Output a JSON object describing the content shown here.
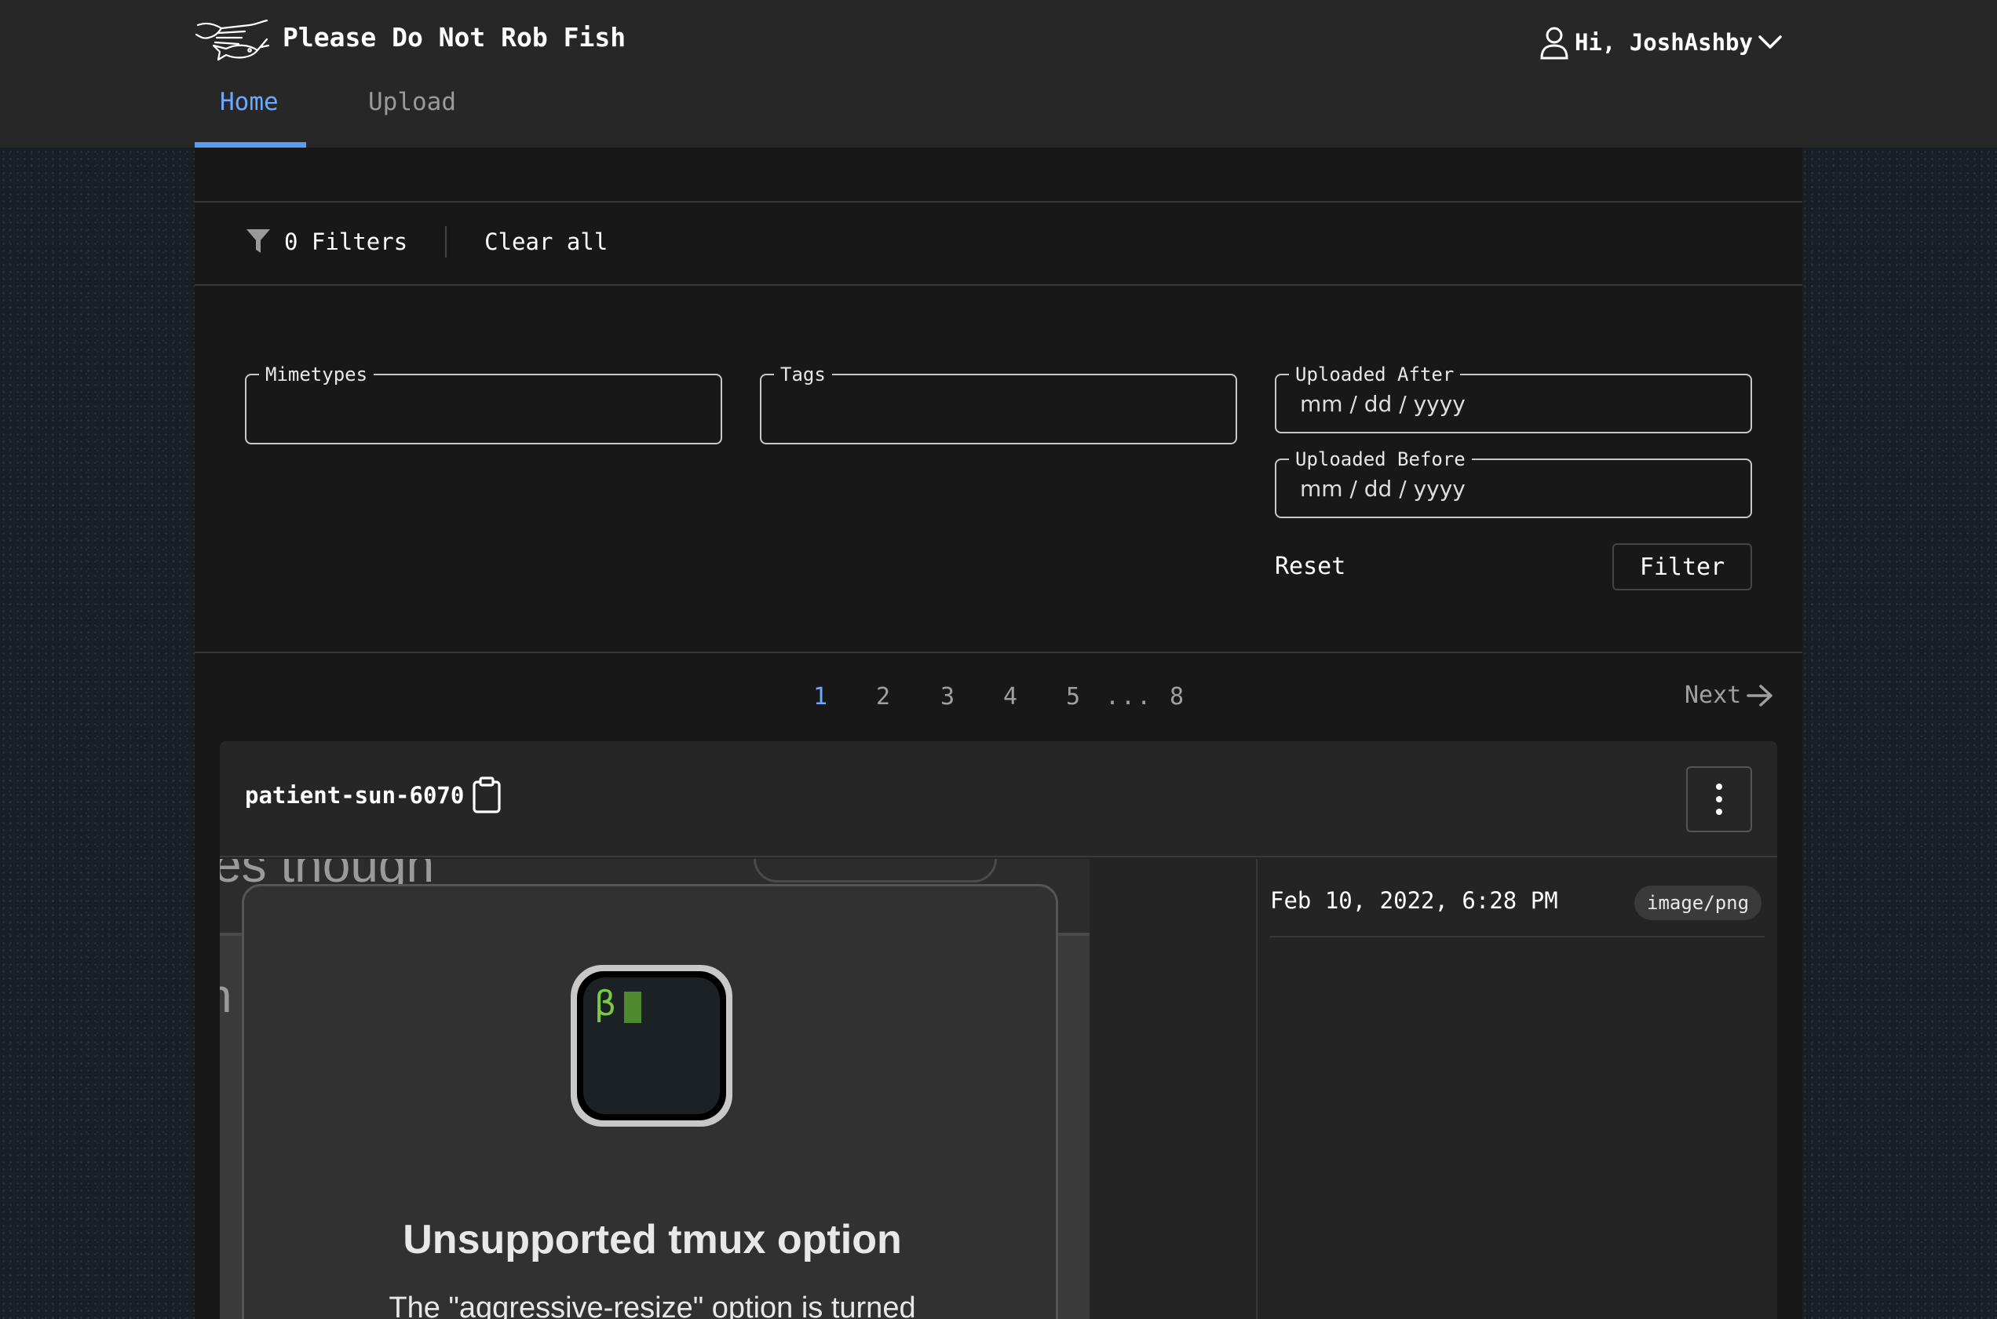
{
  "app": {
    "title": "Please Do Not Rob Fish"
  },
  "user": {
    "greeting": "Hi, JoshAshby"
  },
  "tabs": [
    {
      "label": "Home",
      "active": true
    },
    {
      "label": "Upload",
      "active": false
    }
  ],
  "filters": {
    "count_label": "0 Filters",
    "clear_all": "Clear all",
    "fields": {
      "mimetypes": {
        "legend": "Mimetypes",
        "value": ""
      },
      "tags": {
        "legend": "Tags",
        "value": ""
      },
      "uploaded_after": {
        "legend": "Uploaded After",
        "placeholder": "mm / dd / yyyy"
      },
      "uploaded_before": {
        "legend": "Uploaded Before",
        "placeholder": "mm / dd / yyyy"
      }
    },
    "reset_label": "Reset",
    "filter_label": "Filter"
  },
  "pagination": {
    "pages": [
      "1",
      "2",
      "3",
      "4",
      "5",
      "8"
    ],
    "current": "1",
    "ellipsis": "...",
    "next_label": "Next"
  },
  "upload": {
    "name": "patient-sun-6070",
    "date": "Feb 10, 2022, 6:28 PM",
    "mimetype": "image/png",
    "preview": {
      "ghost_text": "es though",
      "ghost_side": "n",
      "dialog_title": "Unsupported tmux option",
      "dialog_body": "The \"aggressive-resize\" option is turned",
      "icon_glyph": "β"
    }
  },
  "colors": {
    "accent": "#6ea8fe",
    "header_bg": "#272727",
    "panel_bg": "#181818",
    "card_bg": "#242424"
  },
  "icons": {
    "logo": "hand-fish-logo",
    "user": "user-icon",
    "chevron": "chevron-down-icon",
    "filter": "funnel-icon",
    "clipboard": "clipboard-icon",
    "next": "arrow-right-icon",
    "menu": "kebab-menu-icon"
  }
}
